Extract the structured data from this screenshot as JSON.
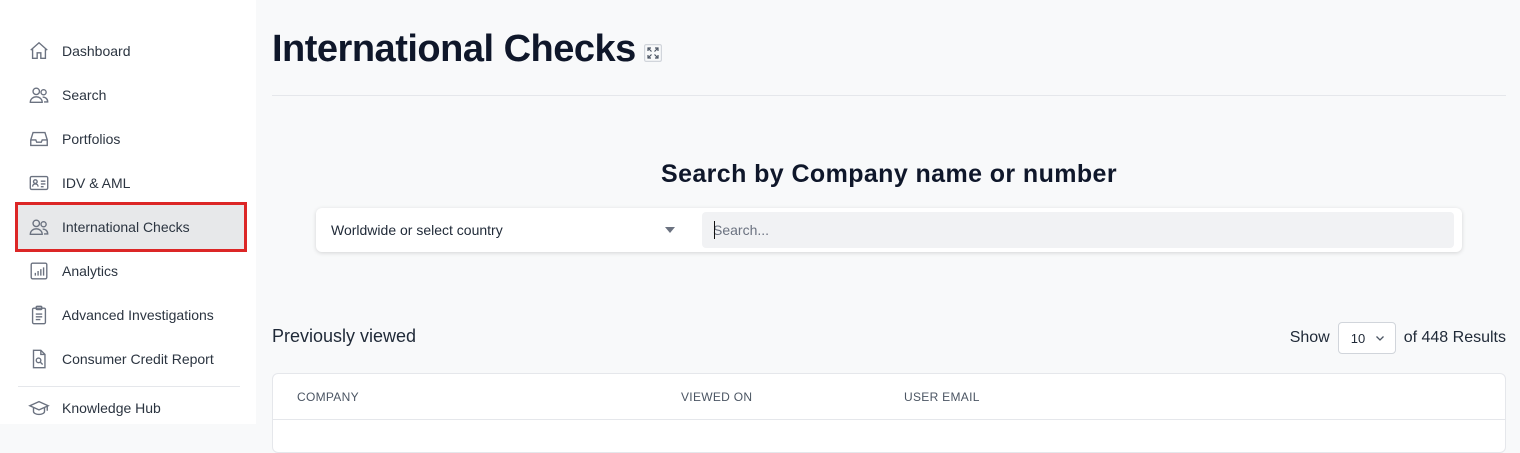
{
  "sidebar": {
    "items": [
      {
        "label": "Dashboard",
        "icon": "home-icon"
      },
      {
        "label": "Search",
        "icon": "users-icon"
      },
      {
        "label": "Portfolios",
        "icon": "inbox-icon"
      },
      {
        "label": "IDV & AML",
        "icon": "id-card-icon"
      },
      {
        "label": "International Checks",
        "icon": "users-icon",
        "active": true
      },
      {
        "label": "Analytics",
        "icon": "bar-chart-icon"
      },
      {
        "label": "Advanced Investigations",
        "icon": "clipboard-icon"
      },
      {
        "label": "Consumer Credit Report",
        "icon": "document-search-icon"
      },
      {
        "label": "Knowledge Hub",
        "icon": "graduation-cap-icon"
      }
    ]
  },
  "header": {
    "title": "International Checks",
    "expand_icon": "expand-icon"
  },
  "search": {
    "heading": "Search by Company name or number",
    "country_value": "Worldwide or select country",
    "placeholder": "Search..."
  },
  "previously_viewed": {
    "title": "Previously viewed",
    "show_label": "Show",
    "page_size": "10",
    "results_text": "of 448 Results"
  },
  "table": {
    "columns": [
      "COMPANY",
      "VIEWED ON",
      "USER EMAIL"
    ]
  },
  "colors": {
    "highlight": "#dc2626",
    "active_bg": "#e7e8ea",
    "title": "#0f172a"
  }
}
